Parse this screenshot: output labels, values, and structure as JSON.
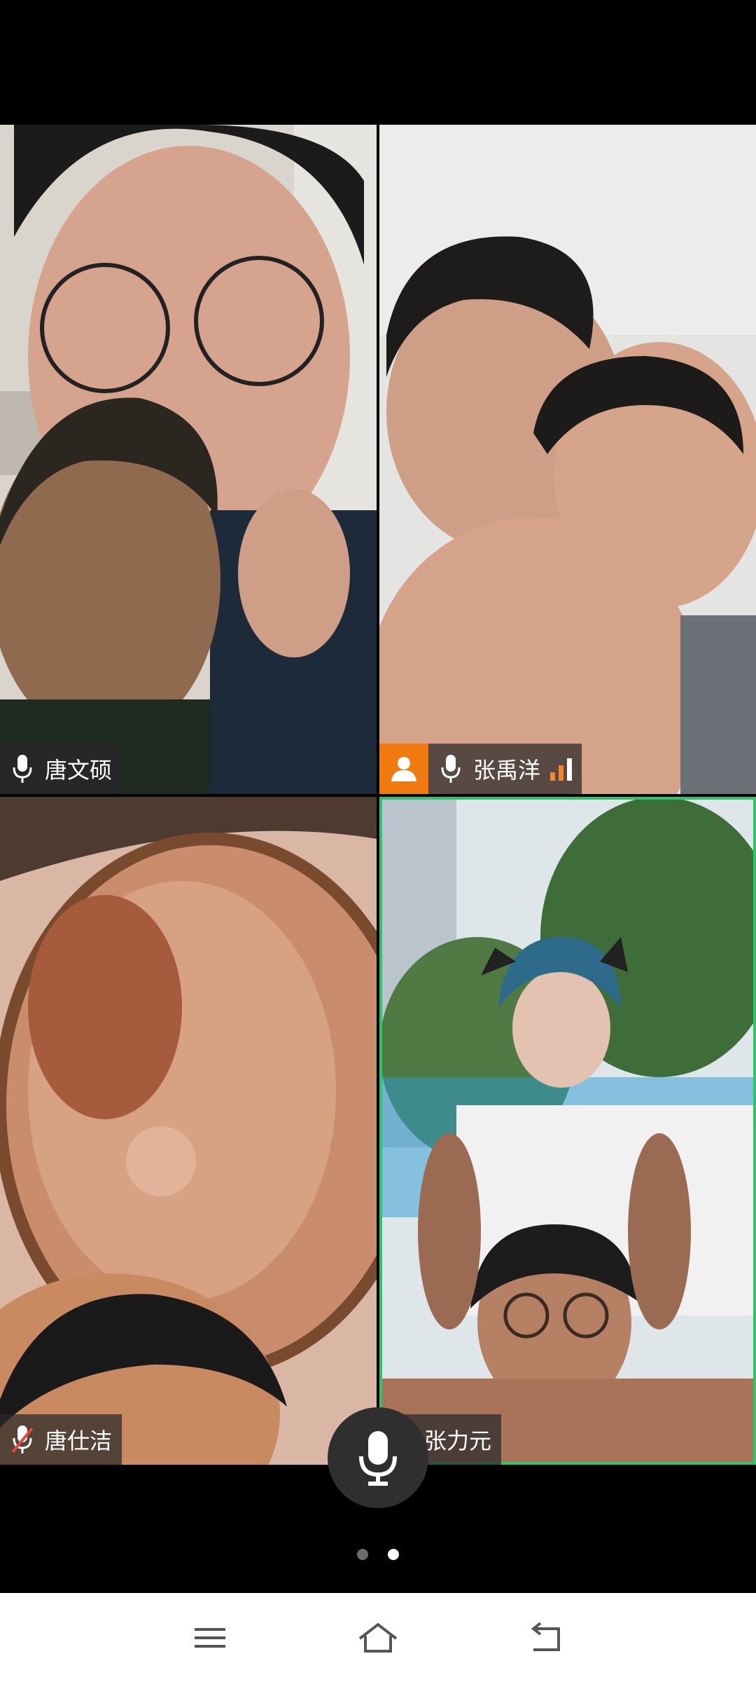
{
  "participants": [
    {
      "name": "唐文硕",
      "mic": "on",
      "host": false,
      "active_speaker": false
    },
    {
      "name": "张禹洋",
      "mic": "on",
      "host": true,
      "active_speaker": false,
      "signal_icon": "signal-strength-icon"
    },
    {
      "name": "唐仕洁",
      "mic": "muted",
      "host": false,
      "active_speaker": false
    },
    {
      "name": "张力元",
      "mic": "on",
      "host": false,
      "active_speaker": true
    }
  ],
  "controls": {
    "mic_icon": "microphone-icon",
    "pages": 2,
    "current_page": 2
  },
  "navigation": {
    "menu_icon": "menu-icon",
    "home_icon": "home-icon",
    "back_icon": "back-icon"
  },
  "colors": {
    "host_badge": "#f07a10",
    "active_border": "#2fc46a",
    "muted_slash": "#e8453c",
    "signal": "#f5862a"
  }
}
